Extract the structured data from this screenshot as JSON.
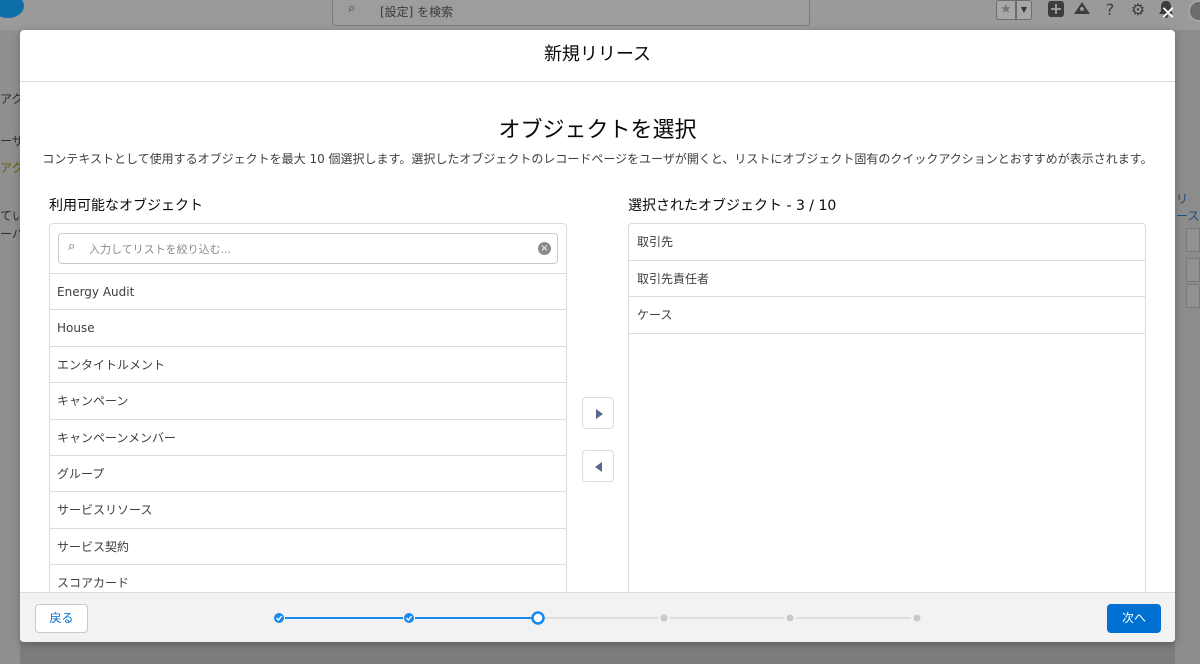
{
  "background": {
    "search_placeholder": "[設定] を検索",
    "left_fragments": [
      "アク",
      "ーザー",
      "アク",
      "ている",
      "ーバ/"
    ],
    "right_fragment": "リース"
  },
  "modal": {
    "title": "新規リリース",
    "step_title": "オブジェクトを選択",
    "description": "コンテキストとして使用するオブジェクトを最大 10 個選択します。選択したオブジェクトのレコードページをユーザが開くと、リストにオブジェクト固有のクイックアクションとおすすめが表示されます。",
    "available": {
      "label": "利用可能なオブジェクト",
      "filter_placeholder": "入力してリストを絞り込む...",
      "items": [
        "Energy Audit",
        "House",
        "エンタイトルメント",
        "キャンペーン",
        "キャンペーンメンバー",
        "グループ",
        "サービスリソース",
        "サービス契約",
        "スコアカード"
      ]
    },
    "selected": {
      "label": "選択されたオブジェクト - 3 / 10",
      "items": [
        "取引先",
        "取引先責任者",
        "ケース"
      ]
    },
    "footer": {
      "back_label": "戻る",
      "next_label": "次へ",
      "steps_total": 6,
      "steps_completed": 2,
      "current_step": 3
    }
  },
  "colors": {
    "brand": "#0070d2",
    "progress_complete": "#1589ee",
    "progress_incomplete": "#c9c9c9"
  },
  "icons": [
    "search-icon",
    "favorite-star-icon",
    "add-icon",
    "trailhead-icon",
    "help-icon",
    "gear-icon",
    "bell-icon",
    "close-icon",
    "clear-icon",
    "move-right-icon",
    "move-left-icon",
    "check-icon"
  ]
}
